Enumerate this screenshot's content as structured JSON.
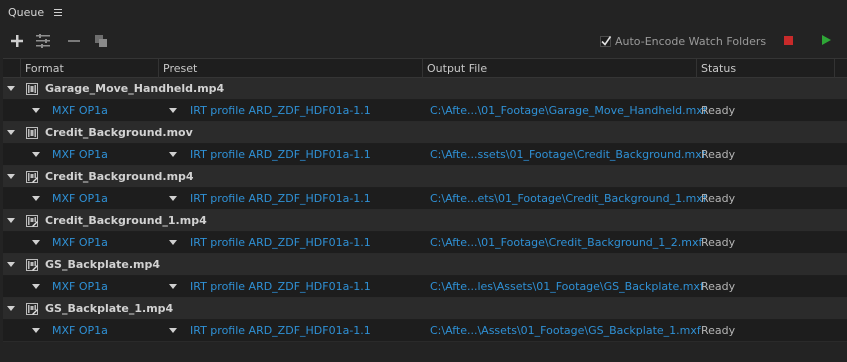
{
  "panel": {
    "title": "Queue"
  },
  "toolbar": {
    "auto_encode_label": "Auto-Encode Watch Folders",
    "auto_encode_checked": true,
    "stop_color": "#c82a2a",
    "start_color": "#2ea636",
    "icons": [
      "add-source-icon",
      "add-output-icon",
      "remove-icon",
      "duplicate-icon",
      "stop-queue-icon",
      "start-queue-icon"
    ]
  },
  "columns": {
    "format": "Format",
    "preset": "Preset",
    "output": "Output File",
    "status": "Status"
  },
  "accent_color": "#2f91d6",
  "items": [
    {
      "source": "Garage_Move_Handheld.mp4",
      "format": "MXF OP1a",
      "preset": "IRT profile ARD_ZDF_HDF01a-1.1",
      "output": "C:\\Afte...\\01_Footage\\Garage_Move_Handheld.mxf",
      "status": "Ready",
      "icon": "film-icon"
    },
    {
      "source": "Credit_Background.mov",
      "format": "MXF OP1a",
      "preset": "IRT profile ARD_ZDF_HDF01a-1.1",
      "output": "C:\\Afte...ssets\\01_Footage\\Credit_Background.mxf",
      "status": "Ready",
      "icon": "film-icon"
    },
    {
      "source": "Credit_Background.mp4",
      "format": "MXF OP1a",
      "preset": "IRT profile ARD_ZDF_HDF01a-1.1",
      "output": "C:\\Afte...ets\\01_Footage\\Credit_Background_1.mxf",
      "status": "Ready",
      "icon": "film-edit-icon"
    },
    {
      "source": "Credit_Background_1.mp4",
      "format": "MXF OP1a",
      "preset": "IRT profile ARD_ZDF_HDF01a-1.1",
      "output": "C:\\Afte...\\01_Footage\\Credit_Background_1_2.mxf",
      "status": "Ready",
      "icon": "film-edit-icon"
    },
    {
      "source": "GS_Backplate.mp4",
      "format": "MXF OP1a",
      "preset": "IRT profile ARD_ZDF_HDF01a-1.1",
      "output": "C:\\Afte...les\\Assets\\01_Footage\\GS_Backplate.mxf",
      "status": "Ready",
      "icon": "film-edit-icon"
    },
    {
      "source": "GS_Backplate_1.mp4",
      "format": "MXF OP1a",
      "preset": "IRT profile ARD_ZDF_HDF01a-1.1",
      "output": "C:\\Afte...\\Assets\\01_Footage\\GS_Backplate_1.mxf",
      "status": "Ready",
      "icon": "film-edit-icon"
    }
  ]
}
